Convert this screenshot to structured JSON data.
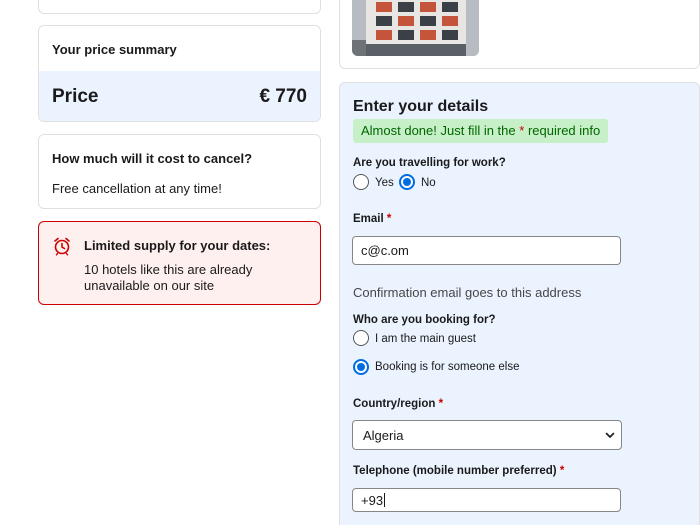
{
  "price_summary": {
    "title": "Your price summary",
    "price_label": "Price",
    "price_value": "€ 770"
  },
  "cancellation": {
    "question": "How much will it cost to cancel?",
    "answer": "Free cancellation at any time!"
  },
  "supply_alert": {
    "title": "Limited supply for your dates:",
    "text": "10 hotels like this are already unavailable on our site"
  },
  "details_form": {
    "heading": "Enter your details",
    "notice_before": "Almost done! Just fill in the",
    "notice_star": "*",
    "notice_after": "required info",
    "work_travel": {
      "question": "Are you travelling for work?",
      "options": [
        "Yes",
        "No"
      ],
      "selected": "No"
    },
    "email": {
      "label": "Email",
      "required_mark": "*",
      "value": "c@c.om",
      "hint": "Confirmation email goes to this address"
    },
    "booking_for": {
      "question": "Who are you booking for?",
      "options": [
        "I am the main guest",
        "Booking is for someone else"
      ],
      "selected": "Booking is for someone else"
    },
    "country": {
      "label": "Country/region",
      "required_mark": "*",
      "value": "Algeria"
    },
    "telephone": {
      "label": "Telephone (mobile number preferred)",
      "required_mark": "*",
      "value": "+93"
    }
  },
  "colors": {
    "accent": "#006ce4",
    "panel_bg": "#ebf3ff",
    "notice_bg": "#c8f0c8",
    "notice_text": "#006600",
    "alert_border": "#cc0000",
    "alert_bg": "#fff0f0"
  },
  "icons": {
    "alert": "alarm-clock-icon",
    "select": "chevron-down-icon"
  }
}
